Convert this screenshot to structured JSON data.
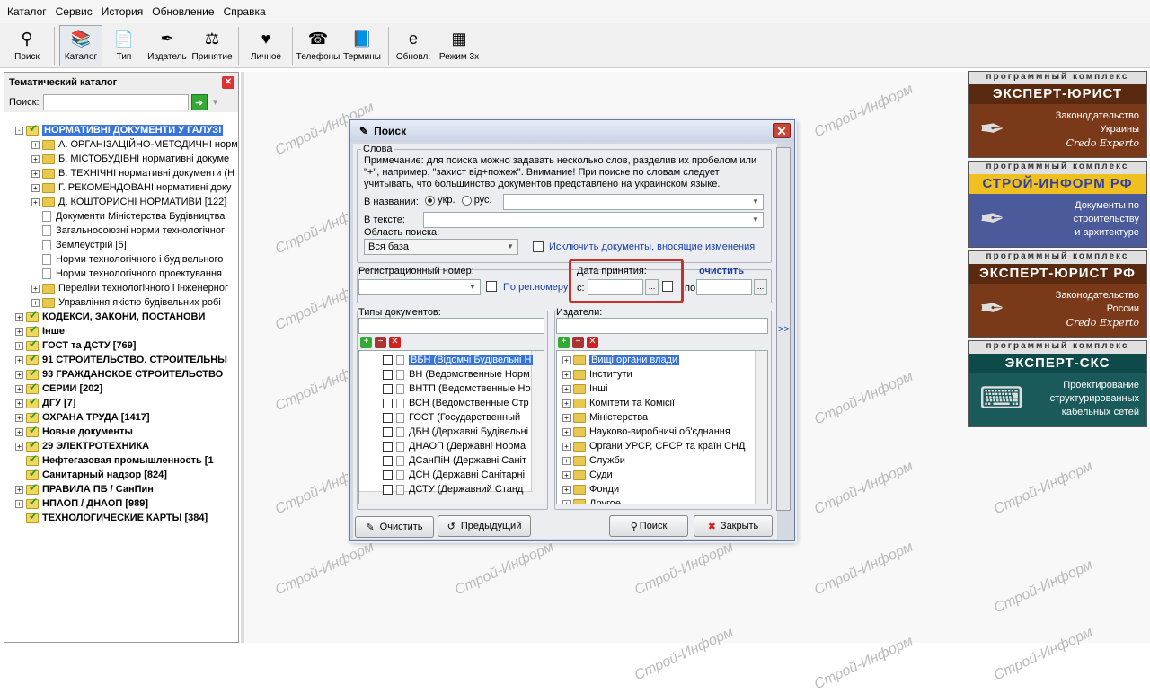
{
  "menu": [
    "Каталог",
    "Сервис",
    "История",
    "Обновление",
    "Справка"
  ],
  "toolbar": [
    {
      "label": "Поиск",
      "icon": "search-icon"
    },
    {
      "label": "Каталог",
      "icon": "catalog-icon"
    },
    {
      "label": "Тип",
      "icon": "type-icon"
    },
    {
      "label": "Издатель",
      "icon": "publisher-icon"
    },
    {
      "label": "Принятие",
      "icon": "adoption-icon"
    },
    {
      "label": "Личное",
      "icon": "personal-icon"
    },
    {
      "label": "Телефоны",
      "icon": "phone-icon"
    },
    {
      "label": "Термины",
      "icon": "terms-icon"
    },
    {
      "label": "Обновл.",
      "icon": "update-icon"
    },
    {
      "label": "Режим 3х",
      "icon": "mode-icon"
    }
  ],
  "left": {
    "title": "Тематический каталог",
    "search_label": "Поиск:",
    "tree": [
      {
        "t": "НОРМАТИВНІ ДОКУМЕНТИ У ГАЛУЗІ",
        "lvl": 0,
        "exp": "-",
        "bold": true,
        "sel": true
      },
      {
        "t": "А. ОРГАНІЗАЦІЙНО-МЕТОДИЧНІ норм",
        "lvl": 1,
        "exp": "+"
      },
      {
        "t": "Б. МІСТОБУДІВНІ нормативні докуме",
        "lvl": 1,
        "exp": "+"
      },
      {
        "t": "В. ТЕХНІЧНІ нормативні документи (Н",
        "lvl": 1,
        "exp": "+"
      },
      {
        "t": "Г. РЕКОМЕНДОВАНІ нормативні доку",
        "lvl": 1,
        "exp": "+"
      },
      {
        "t": "Д. КОШТОРИСНІ НОРМАТИВИ [122]",
        "lvl": 1,
        "exp": "+"
      },
      {
        "t": "Документи Міністерства Будівництва",
        "lvl": 1,
        "exp": "",
        "doc": true
      },
      {
        "t": "Загальносоюзні норми технологічног",
        "lvl": 1,
        "exp": "",
        "doc": true
      },
      {
        "t": "Землеустрій [5]",
        "lvl": 1,
        "exp": "",
        "doc": true
      },
      {
        "t": "Норми технологічного і будівельного",
        "lvl": 1,
        "exp": "",
        "doc": true
      },
      {
        "t": "Норми технологічного проектування",
        "lvl": 1,
        "exp": "",
        "doc": true
      },
      {
        "t": "Переліки технологічного і інженерног",
        "lvl": 1,
        "exp": "+"
      },
      {
        "t": "Управління якістю будівельних робі",
        "lvl": 1,
        "exp": "+"
      },
      {
        "t": "КОДЕКСИ, ЗАКОНИ, ПОСТАНОВИ",
        "lvl": 0,
        "exp": "+",
        "bold": true
      },
      {
        "t": "Інше",
        "lvl": 0,
        "exp": "+",
        "bold": true
      },
      {
        "t": "ГОСТ та ДСТУ [769]",
        "lvl": 0,
        "exp": "+",
        "bold": true
      },
      {
        "t": "91  СТРОИТЕЛЬСТВО. СТРОИТЕЛЬНЫ",
        "lvl": 0,
        "exp": "+",
        "bold": true
      },
      {
        "t": "93  ГРАЖДАНСКОЕ СТРОИТЕЛЬСТВО",
        "lvl": 0,
        "exp": "+",
        "bold": true
      },
      {
        "t": "СЕРИИ [202]",
        "lvl": 0,
        "exp": "+",
        "bold": true
      },
      {
        "t": "ДГУ [7]",
        "lvl": 0,
        "exp": "+",
        "bold": true
      },
      {
        "t": "ОХРАНА ТРУДА [1417]",
        "lvl": 0,
        "exp": "+",
        "bold": true
      },
      {
        "t": "Новые документы",
        "lvl": 0,
        "exp": "+",
        "bold": true
      },
      {
        "t": "29  ЭЛЕКТРОТЕХНИКА",
        "lvl": 0,
        "exp": "+",
        "bold": true
      },
      {
        "t": "Нефтегазовая промышленность [1",
        "lvl": 0,
        "exp": "",
        "bold": true
      },
      {
        "t": "Санитарный надзор [824]",
        "lvl": 0,
        "exp": "",
        "bold": true
      },
      {
        "t": "ПРАВИЛА ПБ / СанПин",
        "lvl": 0,
        "exp": "+",
        "bold": true
      },
      {
        "t": "НПАОП / ДНАОП [989]",
        "lvl": 0,
        "exp": "+",
        "bold": true
      },
      {
        "t": "ТЕХНОЛОГИЧЕСКИЕ КАРТЫ [384]",
        "lvl": 0,
        "exp": "",
        "bold": true
      }
    ]
  },
  "watermark": "Строй-Информ",
  "dialog": {
    "title": "Поиск",
    "group_words": "Слова",
    "note": [
      "Примечание: для поиска можно задавать несколько слов, разделив их пробелом или",
      "\"+\", например, \"захист від+пожеж\". Внимание!  При поиске по словам следует",
      "учитывать, что большинство документов представлено на украинском языке."
    ],
    "in_name": "В названии:",
    "ukr": "укр.",
    "rus": "рус.",
    "in_text": "В тексте:",
    "scope_label": "Область поиска:",
    "scope_value": "Вся база",
    "exclude": "Исключить документы, вносящие изменения",
    "reg_label": "Регистрационный номер:",
    "by_reg": "По рег.номеру",
    "date_label": "Дата принятия:",
    "date_from": "с:",
    "date_to": "по",
    "clear_link": "очистить",
    "dots": "...",
    "types_label": "Типы документов:",
    "types": [
      "ВБН  (Відомчі Будівельні Н",
      "ВН  (Ведомственные Норм",
      "ВНТП  (Ведомственные Но",
      "ВСН  (Ведомственные Стр",
      "ГОСТ  (Государственный",
      "ДБН  (Державні Будівельні",
      "ДНАОП  (Державні Норма",
      "ДСанПіН  (Державні Саніт",
      "ДСН  (Державні Санітарні",
      "ДСТУ  (Державний Станд"
    ],
    "pub_label": "Издатели:",
    "pubs": [
      "Вищі органи влади",
      "Інститути",
      "Інші",
      "Комітети та Комісії",
      "Міністерства",
      "Науково-виробничі об'єднання",
      "Органи УРСР, СРСР та країн СНД",
      "Служби",
      "Суди",
      "Фонди",
      "Другое"
    ],
    "more": ">>",
    "btn_clear": "Очистить",
    "btn_prev": "Предыдущий",
    "btn_search": "Поиск",
    "btn_close": "Закрыть"
  },
  "banners": [
    {
      "top": "программный комплекс",
      "name": "ЭКСПЕРТ-ЮРИСТ",
      "lines": [
        "Законодательство",
        "Украины"
      ],
      "sig": "Credo Experto",
      "bg": "#7a3a1a",
      "namebg": "#5a2a10"
    },
    {
      "top": "программный комплекс",
      "name": "СТРОЙ-ИНФОРМ РФ",
      "lines": [
        "Документы по",
        "строительству",
        "и архитектуре"
      ],
      "sig": "",
      "bg": "#4a5a9a",
      "namebg": "#f0c020"
    },
    {
      "top": "программный комплекс",
      "name": "ЭКСПЕРТ-ЮРИСТ РФ",
      "lines": [
        "Законодательство",
        "России"
      ],
      "sig": "Credo Experto",
      "bg": "#7a3a1a",
      "namebg": "#5a2a10"
    },
    {
      "top": "программный комплекс",
      "name": "ЭКСПЕРТ-СКС",
      "lines": [
        "Проектирование",
        "структурированных",
        "кабельных сетей"
      ],
      "sig": "",
      "bg": "#1a5a5a",
      "namebg": "#0f4a4a"
    }
  ]
}
